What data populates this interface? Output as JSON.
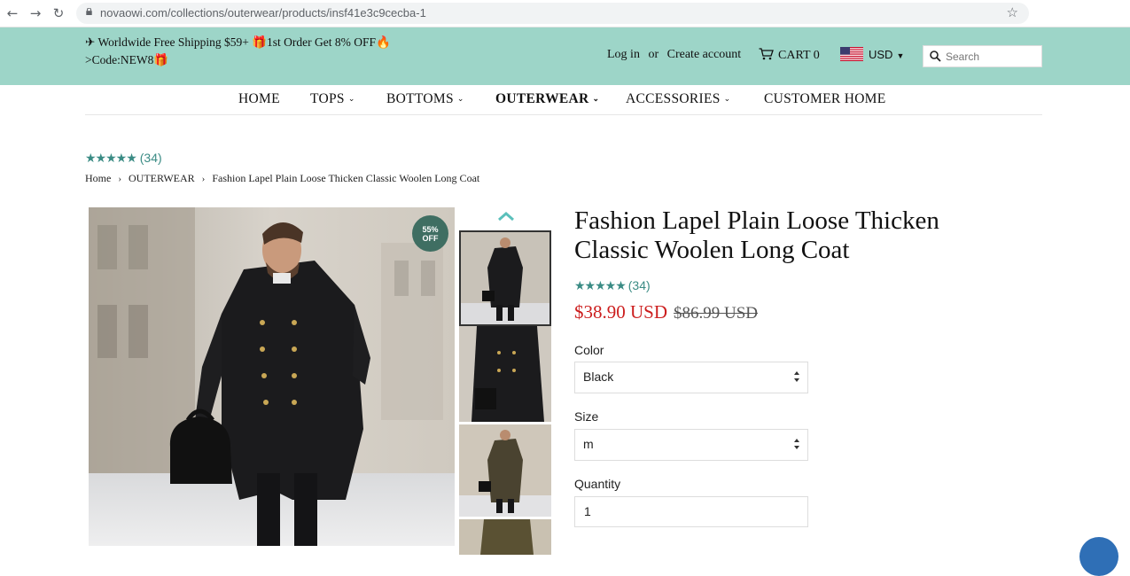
{
  "browser": {
    "url": "novaowi.com/collections/outerwear/products/insf41e3c9cecba-1"
  },
  "promo": {
    "line1": "✈ Worldwide Free Shipping $59+ 🎁1st Order Get 8% OFF🔥",
    "line2": ">Code:NEW8🎁"
  },
  "header": {
    "login": "Log in",
    "or": "or",
    "create_account": "Create account",
    "cart": "CART 0",
    "currency": "USD",
    "search_placeholder": "Search"
  },
  "nav": {
    "items": [
      {
        "label": "HOME",
        "dropdown": false
      },
      {
        "label": "TOPS",
        "dropdown": true
      },
      {
        "label": "BOTTOMS",
        "dropdown": true
      },
      {
        "label": "OUTERWEAR",
        "dropdown": true,
        "active": true
      },
      {
        "label": "ACCESSORIES",
        "dropdown": true
      },
      {
        "label": "CUSTOMER HOME",
        "dropdown": false
      }
    ]
  },
  "review": {
    "stars": "★★★★★",
    "count": "(34)"
  },
  "breadcrumb": {
    "home": "Home",
    "category": "OUTERWEAR",
    "current": "Fashion Lapel Plain Loose Thicken Classic Woolen Long Coat"
  },
  "badge": {
    "line1": "55%",
    "line2": "OFF"
  },
  "product": {
    "title": "Fashion Lapel Plain Loose Thicken Classic Woolen Long Coat",
    "price": "$38.90 USD",
    "compare_price": "$86.99 USD",
    "color_label": "Color",
    "color_value": "Black",
    "size_label": "Size",
    "size_value": "m",
    "quantity_label": "Quantity",
    "quantity_value": "1"
  },
  "colors": {
    "header_bg": "#9dd5c8",
    "accent": "#3a8b84",
    "sale": "#cc1e1e",
    "badge": "#3f6e62"
  }
}
